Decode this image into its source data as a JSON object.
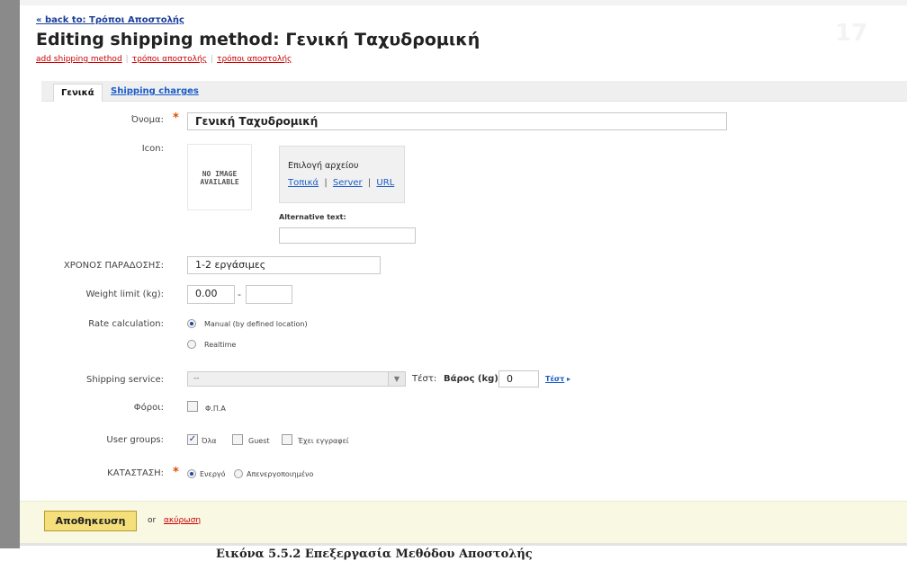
{
  "breadcrumb": {
    "back_label": "« back to: Τρόποι Αποστολής"
  },
  "header": {
    "title": "Editing shipping method: Γενική Ταχυδρομική",
    "links": [
      "add shipping method",
      "τρόποι αποστολής",
      "τρόποι αποστολής"
    ],
    "watermark": "17"
  },
  "tabs": [
    {
      "label": "Γενικά",
      "active": true
    },
    {
      "label": "Shipping charges",
      "active": false
    }
  ],
  "form": {
    "name_label": "Όνομα:",
    "name_value": "Γενική Ταχυδρομική",
    "icon_label": "Icon:",
    "no_image_line1": "NO IMAGE",
    "no_image_line2": "AVAILABLE",
    "file_select_label": "Επιλογή αρχείου",
    "file_source_local": "Τοπικά",
    "file_source_server": "Server",
    "file_source_url": "URL",
    "file_source_sep": "|",
    "alt_text_label": "Alternative text:",
    "alt_text_value": "",
    "delivery_label": "ΧΡΟΝΟΣ ΠΑΡΑΔΟΣΗΣ:",
    "delivery_value": "1-2 εργάσιμες",
    "weight_label": "Weight limit (kg):",
    "weight_min": "0.00",
    "weight_sep": "-",
    "weight_max": "",
    "rate_label": "Rate calculation:",
    "rate_options": [
      {
        "label": "Manual (by defined location)",
        "selected": true
      },
      {
        "label": "Realtime",
        "selected": false
      }
    ],
    "service_label": "Shipping service:",
    "service_value": "--",
    "test_label": "Τέστ:",
    "test_weight_label": "Βάρος (kg)",
    "test_weight_value": "0",
    "test_link": "Τέστ",
    "taxes_label": "Φόροι:",
    "taxes_options": [
      {
        "label": "Φ.Π.Α",
        "checked": false
      }
    ],
    "groups_label": "User groups:",
    "groups_options": [
      {
        "label": "Όλα",
        "checked": true
      },
      {
        "label": "Guest",
        "checked": false
      },
      {
        "label": "Έχει εγγραφεί",
        "checked": false
      }
    ],
    "status_label": "ΚΑΤΑΣΤΑΣΗ:",
    "status_options": [
      {
        "label": "Ενεργό",
        "selected": true
      },
      {
        "label": "Απενεργοποιημένο",
        "selected": false
      }
    ],
    "required_mark": "*"
  },
  "footer": {
    "save_label": "Αποθηκευση",
    "or_label": "or",
    "cancel_label": "ακύρωση"
  },
  "caption": "Εικόνα 5.5.2 Επεξεργασία Μεθόδου Αποστολής"
}
